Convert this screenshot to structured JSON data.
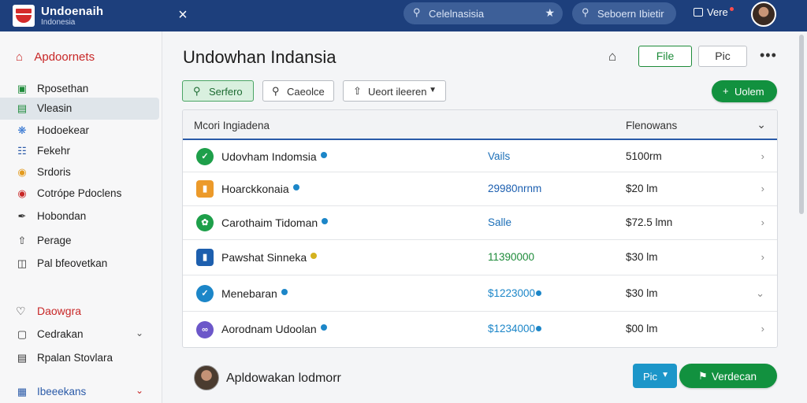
{
  "topbar": {
    "brand_title": "Undoenaih",
    "brand_subtitle": "Indonesia",
    "close_glyph": "×",
    "search_placeholder": "Celelnasisia",
    "search2_placeholder": "Seboern Ibietir",
    "notif_label": "Vere",
    "colors": {
      "bar": "#1d3f7c",
      "search": "#3d5f98",
      "logo_red": "#d42b2b"
    }
  },
  "sidebar": {
    "header": "Apdoornets",
    "items": [
      {
        "label": "Rposethan",
        "icon": "card-icon"
      },
      {
        "label": "Vleasin",
        "icon": "wallet-icon",
        "active": true
      },
      {
        "label": "Hodoekear",
        "icon": "gear-icon"
      },
      {
        "label": "Fekehr",
        "icon": "doc-icon"
      },
      {
        "label": "Srdoris",
        "icon": "coin-icon"
      },
      {
        "label": "Cotrópe Pdoclens",
        "icon": "chat-icon"
      },
      {
        "label": "Hobondan",
        "icon": "pen-icon"
      },
      {
        "label": "Perage",
        "icon": "upload-icon"
      },
      {
        "label": "Pal bfeovetkan",
        "icon": "print-icon"
      }
    ],
    "section_label": "Daowgra",
    "section_items": [
      {
        "label": "Cedrakan",
        "icon": "lock-icon"
      },
      {
        "label": "Rpalan Stovlara",
        "icon": "file-icon"
      },
      {
        "label": "Ibeeekans",
        "icon": "grid-icon"
      }
    ],
    "active_color": "#dfe5ea",
    "accent_color": "#c82727"
  },
  "main": {
    "title": "Undowhan Indansia",
    "file_label": "File",
    "pic_label": "Pic",
    "more_glyph": "•••",
    "search_label": "Serfero",
    "filter_label": "Caeolce",
    "sort_label": "Ueort ileeren",
    "update_label": "Uolem",
    "green": "#12913f"
  },
  "table": {
    "header_name": "Mcori Ingiadena",
    "header_value": "Flenowans",
    "rows": [
      {
        "name": "Udovham Indomsia",
        "status": "Vails",
        "amount": "5100rm",
        "icon_color": "#1e9f4a",
        "status_color": "#1c6fb8",
        "icon": "circle-check-icon"
      },
      {
        "name": "Hoarckkonaia",
        "status": "29980nrnm",
        "amount": "$20 lm",
        "icon_color": "#ec9a2a",
        "status_color": "#1c5fb0",
        "icon": "square-badge-icon"
      },
      {
        "name": "Carothaim Tidoman",
        "status": "Salle",
        "amount": "$72.5 lmn",
        "icon_color": "#1e9f4a",
        "status_color": "#1c6fb8",
        "icon": "leaf-icon"
      },
      {
        "name": "Pawshat Sinneka",
        "status": "11390000",
        "amount": "$30 lm",
        "icon_color": "#1d5fae",
        "status_color": "#1e8b3a",
        "icon": "book-icon"
      },
      {
        "name": "Menebaran",
        "status": "$1223000",
        "amount": "$30 lm",
        "icon_color": "#1c86c8",
        "status_color": "#1c86c8",
        "icon": "check-icon"
      },
      {
        "name": "Aorodnam Udoolan",
        "status": "$1234000",
        "amount": "$00 lm",
        "icon_color": "#6c57c9",
        "status_color": "#1c86c8",
        "icon": "user-group-icon"
      }
    ]
  },
  "footer": {
    "name": "Apldowakan lodmorr",
    "pic_label": "Pic",
    "verified_label": "Verdecan"
  }
}
